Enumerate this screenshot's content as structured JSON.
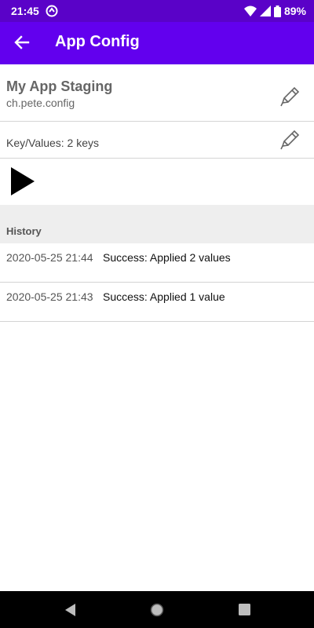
{
  "status": {
    "time": "21:45",
    "battery": "89%",
    "icons": [
      "sync-icon",
      "wifi-icon",
      "signal-icon",
      "battery-icon"
    ]
  },
  "app_bar": {
    "title": "App Config",
    "back_icon": "arrow-left-icon"
  },
  "config": {
    "name": "My App Staging",
    "id": "ch.pete.config",
    "edit_icon": "pencil-icon"
  },
  "keyvalues": {
    "label": "Key/Values:  2 keys",
    "edit_icon": "pencil-icon"
  },
  "play": {
    "icon": "play-icon"
  },
  "history": {
    "title": "History",
    "items": [
      {
        "date": "2020-05-25 21:44",
        "message": "Success: Applied 2 values"
      },
      {
        "date": "2020-05-25 21:43",
        "message": "Success: Applied 1 value"
      }
    ]
  },
  "nav": {
    "icons": [
      "back-triangle-icon",
      "home-circle-icon",
      "recents-square-icon"
    ]
  },
  "colors": {
    "status_bar": "#5a02c8",
    "app_bar": "#6200ee",
    "history_header_bg": "#eeeeee",
    "divider": "#d4d4d4"
  }
}
